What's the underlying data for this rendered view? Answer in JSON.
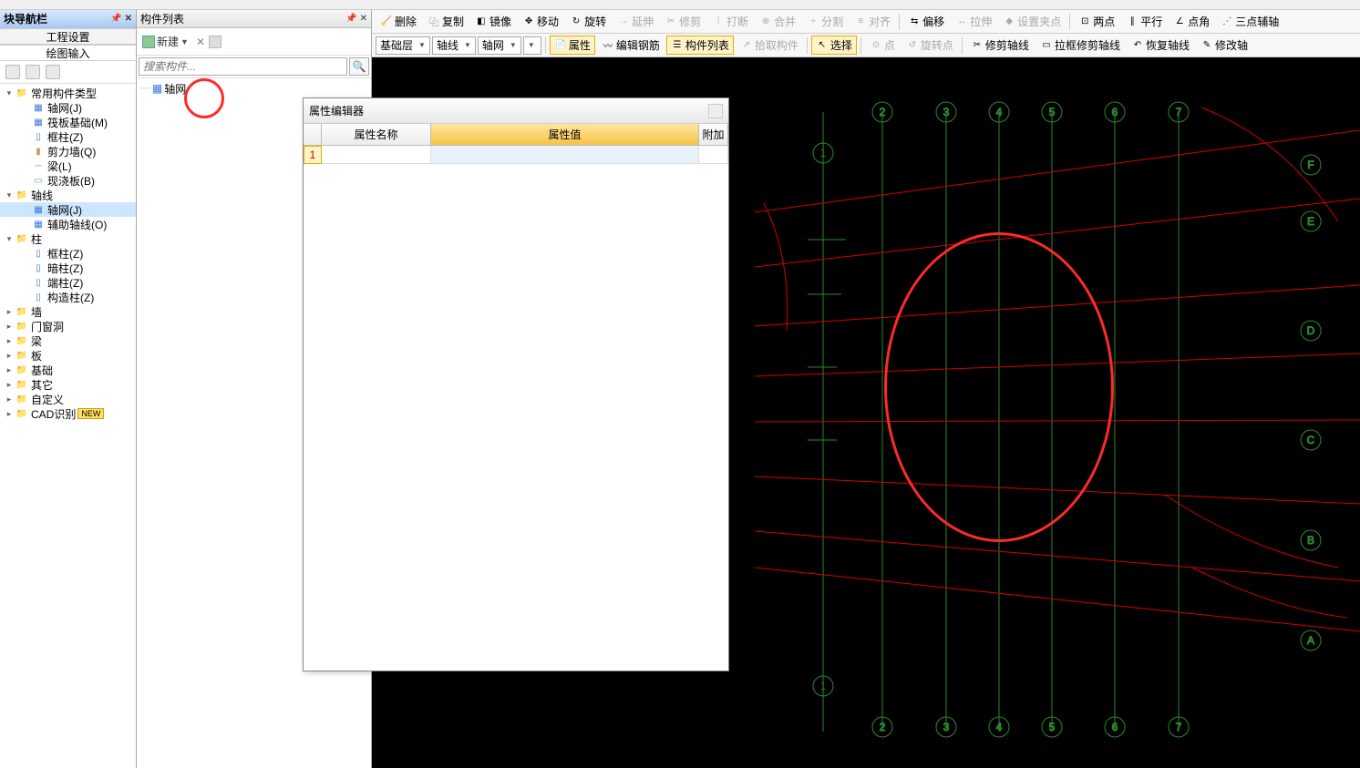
{
  "nav": {
    "title": "块导航栏",
    "tabs": {
      "settings": "工程设置",
      "input": "绘图输入"
    },
    "items": [
      {
        "label": "常用构件类型",
        "type": "folder",
        "indent": 0,
        "arrow": "▾"
      },
      {
        "label": "轴网(J)",
        "type": "grid",
        "indent": 1
      },
      {
        "label": "筏板基础(M)",
        "type": "grid",
        "indent": 1
      },
      {
        "label": "框柱(Z)",
        "type": "col",
        "indent": 1
      },
      {
        "label": "剪力墙(Q)",
        "type": "wall",
        "indent": 1
      },
      {
        "label": "梁(L)",
        "type": "beam",
        "indent": 1
      },
      {
        "label": "现浇板(B)",
        "type": "slab",
        "indent": 1
      },
      {
        "label": "轴线",
        "type": "folder",
        "indent": 0,
        "arrow": "▾"
      },
      {
        "label": "轴网(J)",
        "type": "grid",
        "indent": 1,
        "selected": true
      },
      {
        "label": "辅助轴线(O)",
        "type": "grid",
        "indent": 1
      },
      {
        "label": "柱",
        "type": "folder",
        "indent": 0,
        "arrow": "▾"
      },
      {
        "label": "框柱(Z)",
        "type": "col",
        "indent": 1
      },
      {
        "label": "暗柱(Z)",
        "type": "col",
        "indent": 1
      },
      {
        "label": "端柱(Z)",
        "type": "col",
        "indent": 1
      },
      {
        "label": "构造柱(Z)",
        "type": "col",
        "indent": 1
      },
      {
        "label": "墙",
        "type": "folder",
        "indent": 0,
        "arrow": "▸"
      },
      {
        "label": "门窗洞",
        "type": "folder",
        "indent": 0,
        "arrow": "▸"
      },
      {
        "label": "梁",
        "type": "folder",
        "indent": 0,
        "arrow": "▸"
      },
      {
        "label": "板",
        "type": "folder",
        "indent": 0,
        "arrow": "▸"
      },
      {
        "label": "基础",
        "type": "folder",
        "indent": 0,
        "arrow": "▸"
      },
      {
        "label": "其它",
        "type": "folder",
        "indent": 0,
        "arrow": "▸"
      },
      {
        "label": "自定义",
        "type": "folder",
        "indent": 0,
        "arrow": "▸"
      },
      {
        "label": "CAD识别",
        "type": "folder",
        "indent": 0,
        "arrow": "▸",
        "badge": "NEW"
      }
    ]
  },
  "list_panel": {
    "title": "构件列表",
    "new_label": "新建",
    "search_placeholder": "搜索构件...",
    "root_item": "轴网"
  },
  "toolbar1": {
    "delete": "删除",
    "copy": "复制",
    "mirror": "镜像",
    "move": "移动",
    "rotate": "旋转",
    "extend": "延伸",
    "trim": "修剪",
    "break": "打断",
    "merge": "合并",
    "split": "分割",
    "align": "对齐",
    "offset": "偏移",
    "stretch": "拉伸",
    "fixpoint": "设置夹点",
    "two_point": "两点",
    "parallel": "平行",
    "point_angle": "点角",
    "three_aux": "三点辅轴"
  },
  "toolbar2": {
    "layer": "基础层",
    "cat": "轴线",
    "comp": "轴网",
    "props": "属性",
    "edit_bar": "编辑钢筋",
    "comp_list": "构件列表",
    "pick": "拾取构件",
    "select": "选择",
    "point": "点",
    "rot_point": "旋转点",
    "trim_axis": "修剪轴线",
    "box_trim_axis": "拉框修剪轴线",
    "restore_axis": "恢复轴线",
    "modify_axis": "修改轴"
  },
  "prop_editor": {
    "title": "属性编辑器",
    "columns": {
      "name": "属性名称",
      "value": "属性值",
      "add": "附加"
    },
    "row1_index": "1"
  },
  "canvas": {
    "top_labels": [
      "1",
      "2",
      "3",
      "4",
      "5",
      "6",
      "7"
    ],
    "right_labels": [
      "F",
      "E",
      "D",
      "C",
      "B",
      "A"
    ],
    "bottom_labels": [
      "1",
      "2",
      "3",
      "4",
      "5",
      "6",
      "7"
    ],
    "left_extra": "1"
  }
}
